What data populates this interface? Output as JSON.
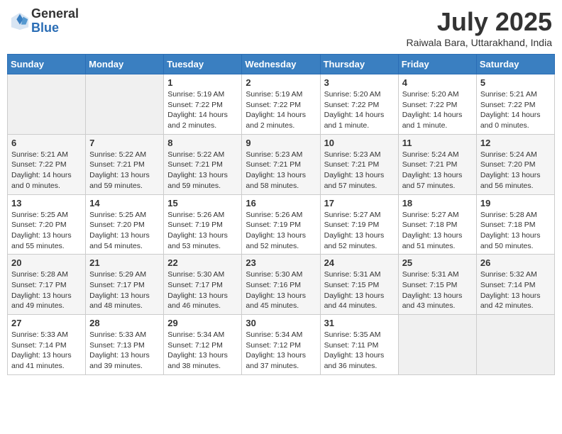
{
  "header": {
    "logo_general": "General",
    "logo_blue": "Blue",
    "month_title": "July 2025",
    "subtitle": "Raiwala Bara, Uttarakhand, India"
  },
  "weekdays": [
    "Sunday",
    "Monday",
    "Tuesday",
    "Wednesday",
    "Thursday",
    "Friday",
    "Saturday"
  ],
  "weeks": [
    [
      {
        "day": "",
        "sunrise": "",
        "sunset": "",
        "daylight": ""
      },
      {
        "day": "",
        "sunrise": "",
        "sunset": "",
        "daylight": ""
      },
      {
        "day": "1",
        "sunrise": "Sunrise: 5:19 AM",
        "sunset": "Sunset: 7:22 PM",
        "daylight": "Daylight: 14 hours and 2 minutes."
      },
      {
        "day": "2",
        "sunrise": "Sunrise: 5:19 AM",
        "sunset": "Sunset: 7:22 PM",
        "daylight": "Daylight: 14 hours and 2 minutes."
      },
      {
        "day": "3",
        "sunrise": "Sunrise: 5:20 AM",
        "sunset": "Sunset: 7:22 PM",
        "daylight": "Daylight: 14 hours and 1 minute."
      },
      {
        "day": "4",
        "sunrise": "Sunrise: 5:20 AM",
        "sunset": "Sunset: 7:22 PM",
        "daylight": "Daylight: 14 hours and 1 minute."
      },
      {
        "day": "5",
        "sunrise": "Sunrise: 5:21 AM",
        "sunset": "Sunset: 7:22 PM",
        "daylight": "Daylight: 14 hours and 0 minutes."
      }
    ],
    [
      {
        "day": "6",
        "sunrise": "Sunrise: 5:21 AM",
        "sunset": "Sunset: 7:22 PM",
        "daylight": "Daylight: 14 hours and 0 minutes."
      },
      {
        "day": "7",
        "sunrise": "Sunrise: 5:22 AM",
        "sunset": "Sunset: 7:21 PM",
        "daylight": "Daylight: 13 hours and 59 minutes."
      },
      {
        "day": "8",
        "sunrise": "Sunrise: 5:22 AM",
        "sunset": "Sunset: 7:21 PM",
        "daylight": "Daylight: 13 hours and 59 minutes."
      },
      {
        "day": "9",
        "sunrise": "Sunrise: 5:23 AM",
        "sunset": "Sunset: 7:21 PM",
        "daylight": "Daylight: 13 hours and 58 minutes."
      },
      {
        "day": "10",
        "sunrise": "Sunrise: 5:23 AM",
        "sunset": "Sunset: 7:21 PM",
        "daylight": "Daylight: 13 hours and 57 minutes."
      },
      {
        "day": "11",
        "sunrise": "Sunrise: 5:24 AM",
        "sunset": "Sunset: 7:21 PM",
        "daylight": "Daylight: 13 hours and 57 minutes."
      },
      {
        "day": "12",
        "sunrise": "Sunrise: 5:24 AM",
        "sunset": "Sunset: 7:20 PM",
        "daylight": "Daylight: 13 hours and 56 minutes."
      }
    ],
    [
      {
        "day": "13",
        "sunrise": "Sunrise: 5:25 AM",
        "sunset": "Sunset: 7:20 PM",
        "daylight": "Daylight: 13 hours and 55 minutes."
      },
      {
        "day": "14",
        "sunrise": "Sunrise: 5:25 AM",
        "sunset": "Sunset: 7:20 PM",
        "daylight": "Daylight: 13 hours and 54 minutes."
      },
      {
        "day": "15",
        "sunrise": "Sunrise: 5:26 AM",
        "sunset": "Sunset: 7:19 PM",
        "daylight": "Daylight: 13 hours and 53 minutes."
      },
      {
        "day": "16",
        "sunrise": "Sunrise: 5:26 AM",
        "sunset": "Sunset: 7:19 PM",
        "daylight": "Daylight: 13 hours and 52 minutes."
      },
      {
        "day": "17",
        "sunrise": "Sunrise: 5:27 AM",
        "sunset": "Sunset: 7:19 PM",
        "daylight": "Daylight: 13 hours and 52 minutes."
      },
      {
        "day": "18",
        "sunrise": "Sunrise: 5:27 AM",
        "sunset": "Sunset: 7:18 PM",
        "daylight": "Daylight: 13 hours and 51 minutes."
      },
      {
        "day": "19",
        "sunrise": "Sunrise: 5:28 AM",
        "sunset": "Sunset: 7:18 PM",
        "daylight": "Daylight: 13 hours and 50 minutes."
      }
    ],
    [
      {
        "day": "20",
        "sunrise": "Sunrise: 5:28 AM",
        "sunset": "Sunset: 7:17 PM",
        "daylight": "Daylight: 13 hours and 49 minutes."
      },
      {
        "day": "21",
        "sunrise": "Sunrise: 5:29 AM",
        "sunset": "Sunset: 7:17 PM",
        "daylight": "Daylight: 13 hours and 48 minutes."
      },
      {
        "day": "22",
        "sunrise": "Sunrise: 5:30 AM",
        "sunset": "Sunset: 7:17 PM",
        "daylight": "Daylight: 13 hours and 46 minutes."
      },
      {
        "day": "23",
        "sunrise": "Sunrise: 5:30 AM",
        "sunset": "Sunset: 7:16 PM",
        "daylight": "Daylight: 13 hours and 45 minutes."
      },
      {
        "day": "24",
        "sunrise": "Sunrise: 5:31 AM",
        "sunset": "Sunset: 7:15 PM",
        "daylight": "Daylight: 13 hours and 44 minutes."
      },
      {
        "day": "25",
        "sunrise": "Sunrise: 5:31 AM",
        "sunset": "Sunset: 7:15 PM",
        "daylight": "Daylight: 13 hours and 43 minutes."
      },
      {
        "day": "26",
        "sunrise": "Sunrise: 5:32 AM",
        "sunset": "Sunset: 7:14 PM",
        "daylight": "Daylight: 13 hours and 42 minutes."
      }
    ],
    [
      {
        "day": "27",
        "sunrise": "Sunrise: 5:33 AM",
        "sunset": "Sunset: 7:14 PM",
        "daylight": "Daylight: 13 hours and 41 minutes."
      },
      {
        "day": "28",
        "sunrise": "Sunrise: 5:33 AM",
        "sunset": "Sunset: 7:13 PM",
        "daylight": "Daylight: 13 hours and 39 minutes."
      },
      {
        "day": "29",
        "sunrise": "Sunrise: 5:34 AM",
        "sunset": "Sunset: 7:12 PM",
        "daylight": "Daylight: 13 hours and 38 minutes."
      },
      {
        "day": "30",
        "sunrise": "Sunrise: 5:34 AM",
        "sunset": "Sunset: 7:12 PM",
        "daylight": "Daylight: 13 hours and 37 minutes."
      },
      {
        "day": "31",
        "sunrise": "Sunrise: 5:35 AM",
        "sunset": "Sunset: 7:11 PM",
        "daylight": "Daylight: 13 hours and 36 minutes."
      },
      {
        "day": "",
        "sunrise": "",
        "sunset": "",
        "daylight": ""
      },
      {
        "day": "",
        "sunrise": "",
        "sunset": "",
        "daylight": ""
      }
    ]
  ]
}
